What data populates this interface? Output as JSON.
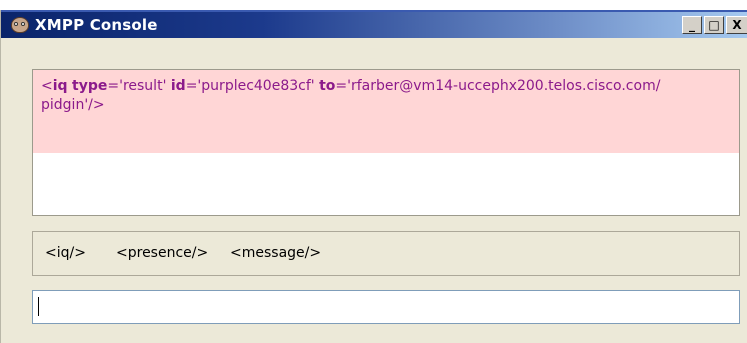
{
  "window": {
    "title": "XMPP Console",
    "icon": "pidgin-icon",
    "controls": {
      "minimize": "_",
      "maximize": "□",
      "close": "X"
    }
  },
  "log": {
    "entry": {
      "open": "<",
      "tag": "iq",
      "attr1_name": "type",
      "attr1_eq": "='",
      "attr1_value": "result",
      "attr1_close": "'",
      "attr2_name": "id",
      "attr2_eq": "='",
      "attr2_value": "purplec40e83cf",
      "attr2_close": "'",
      "attr3_name": "to",
      "attr3_eq": "='",
      "attr3_value": "rfarber@vm14-uccephx200.telos.cisco.com/",
      "attr3_value_cont": "pidgin",
      "attr3_close": "'",
      "end": "/>"
    },
    "highlight_color": "#ffd6d6"
  },
  "toolbar": {
    "iq": "<iq/>",
    "presence": "<presence/>",
    "message": "<message/>"
  },
  "input": {
    "value": ""
  }
}
